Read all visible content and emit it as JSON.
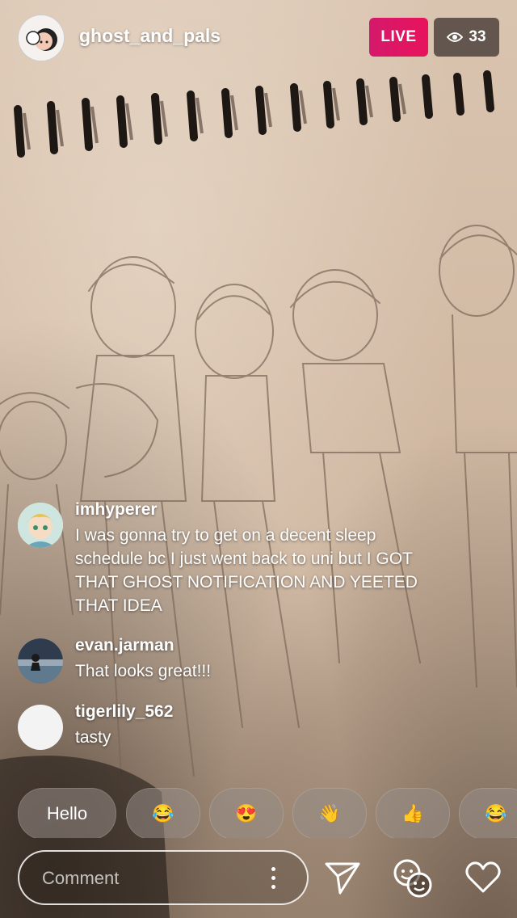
{
  "header": {
    "username": "ghost_and_pals",
    "live_label": "LIVE",
    "viewer_count": "33"
  },
  "comments": [
    {
      "user": "imhyperer",
      "text": "I was gonna try to get on a decent sleep schedule bc I just went back to uni but I GOT THAT GHOST NOTIFICATION AND YEETED THAT IDEA"
    },
    {
      "user": "evan.jarman",
      "text": "That looks great!!!"
    },
    {
      "user": "tigerlily_562",
      "text": "tasty"
    }
  ],
  "quick_replies": [
    {
      "label": "Hello"
    },
    {
      "label": "😂"
    },
    {
      "label": "😍"
    },
    {
      "label": "👋"
    },
    {
      "label": "👍"
    },
    {
      "label": "😂"
    }
  ],
  "composer": {
    "placeholder": "Comment"
  },
  "icons": {
    "viewers": "eye-icon",
    "more": "more-vertical-icon",
    "send": "paper-plane-icon",
    "guests": "faces-icon",
    "like": "heart-icon"
  }
}
